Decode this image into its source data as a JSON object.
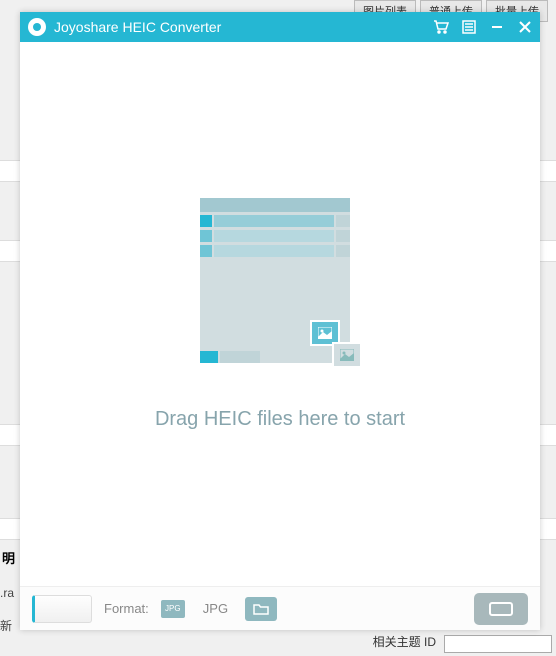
{
  "background": {
    "tabs": [
      "图片列表",
      "普通上传",
      "批量上传"
    ],
    "bottom_label": "相关主题 ID",
    "left_label_1": "明",
    "left_label_2": ".ra",
    "left_label_3": "新"
  },
  "titlebar": {
    "title": "Joyoshare HEIC Converter"
  },
  "main": {
    "drop_text": "Drag HEIC files here to start"
  },
  "bottombar": {
    "format_label": "Format:",
    "format_badge": "JPG",
    "format_value": "JPG"
  }
}
